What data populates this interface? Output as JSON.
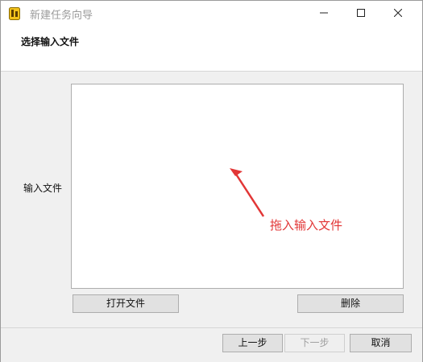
{
  "window": {
    "title": "新建任务向导",
    "controls": {
      "minimize_icon": "minimize-icon",
      "maximize_icon": "maximize-icon",
      "close_icon": "close-icon"
    }
  },
  "header": {
    "title": "选择输入文件"
  },
  "main": {
    "input_label": "输入文件",
    "drop_hint": "拖入输入文件",
    "hint_color": "#e23636",
    "open_file_button": "打开文件",
    "delete_button": "删除"
  },
  "footer": {
    "prev_button": "上一步",
    "next_button": "下一步",
    "next_disabled": true,
    "cancel_button": "取消"
  }
}
